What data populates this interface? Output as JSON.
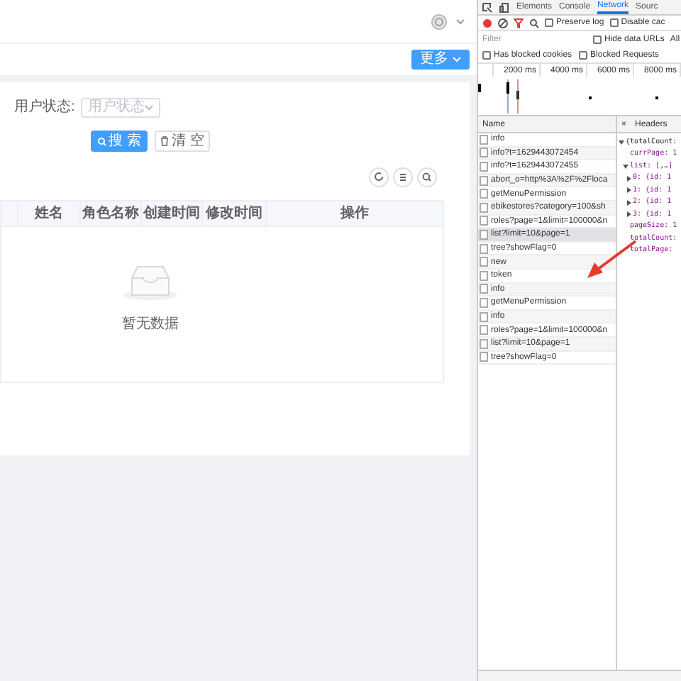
{
  "app": {
    "more_button": "更多",
    "filter_label": "用户状态:",
    "filter_placeholder": "用户状态",
    "search_button": "搜 索",
    "clear_button": "清 空",
    "columns": [
      "姓名",
      "角色名称",
      "创建时间",
      "修改时间",
      "操作"
    ],
    "empty_text": "暂无数据"
  },
  "devtools": {
    "tabs": [
      {
        "label": "Elements",
        "selected": false
      },
      {
        "label": "Console",
        "selected": false
      },
      {
        "label": "Network",
        "selected": true
      },
      {
        "label": "Sourc",
        "selected": false
      }
    ],
    "toolbar_options": [
      {
        "label": "Preserve log",
        "checked": false
      },
      {
        "label": "Disable cac",
        "checked": false
      }
    ],
    "filter_placeholder": "Filter",
    "filter_options": [
      {
        "label": "Hide data URLs",
        "checked": false
      }
    ],
    "type_all": "All",
    "blocked_options": [
      {
        "label": "Has blocked cookies",
        "checked": false
      },
      {
        "label": "Blocked Requests",
        "checked": false
      }
    ],
    "timeline_ticks": [
      "2000 ms",
      "4000 ms",
      "6000 ms",
      "8000 ms"
    ],
    "name_header": "Name",
    "requests": [
      {
        "name": "info",
        "selected": false
      },
      {
        "name": "info?t=1629443072454",
        "selected": false
      },
      {
        "name": "info?t=1629443072455",
        "selected": false
      },
      {
        "name": "abort_o=http%3A%2F%2Floca",
        "selected": false
      },
      {
        "name": "getMenuPermission",
        "selected": false
      },
      {
        "name": "ebikestores?category=100&sh",
        "selected": false
      },
      {
        "name": "roles?page=1&limit=100000&n",
        "selected": false
      },
      {
        "name": "list?limit=10&page=1",
        "selected": true
      },
      {
        "name": "tree?showFlag=0",
        "selected": false
      },
      {
        "name": "new",
        "selected": false
      },
      {
        "name": "token",
        "selected": false
      },
      {
        "name": "info",
        "selected": false
      },
      {
        "name": "getMenuPermission",
        "selected": false
      },
      {
        "name": "info",
        "selected": false
      },
      {
        "name": "roles?page=1&limit=100000&n",
        "selected": false
      },
      {
        "name": "list?limit=10&page=1",
        "selected": false
      },
      {
        "name": "tree?showFlag=0",
        "selected": false
      }
    ],
    "close": "×",
    "detail_tabs": [
      {
        "label": "Headers",
        "selected": false
      }
    ],
    "preview": [
      {
        "text": "{totalCount:",
        "expanded": true,
        "children": [
          {
            "text": "currPage: 1"
          },
          {
            "text": "list: [,…]",
            "expanded": true,
            "children": [
              {
                "text": "0: {id: 1",
                "expanded": false
              },
              {
                "text": "1: {id: 1",
                "expanded": false
              },
              {
                "text": "2: {id: 1",
                "expanded": false
              },
              {
                "text": "3: {id: 1",
                "expanded": false
              }
            ]
          },
          {
            "text": "pageSize: 1"
          },
          {
            "text": "totalCount:"
          },
          {
            "text": "totalPage:"
          }
        ]
      }
    ]
  }
}
